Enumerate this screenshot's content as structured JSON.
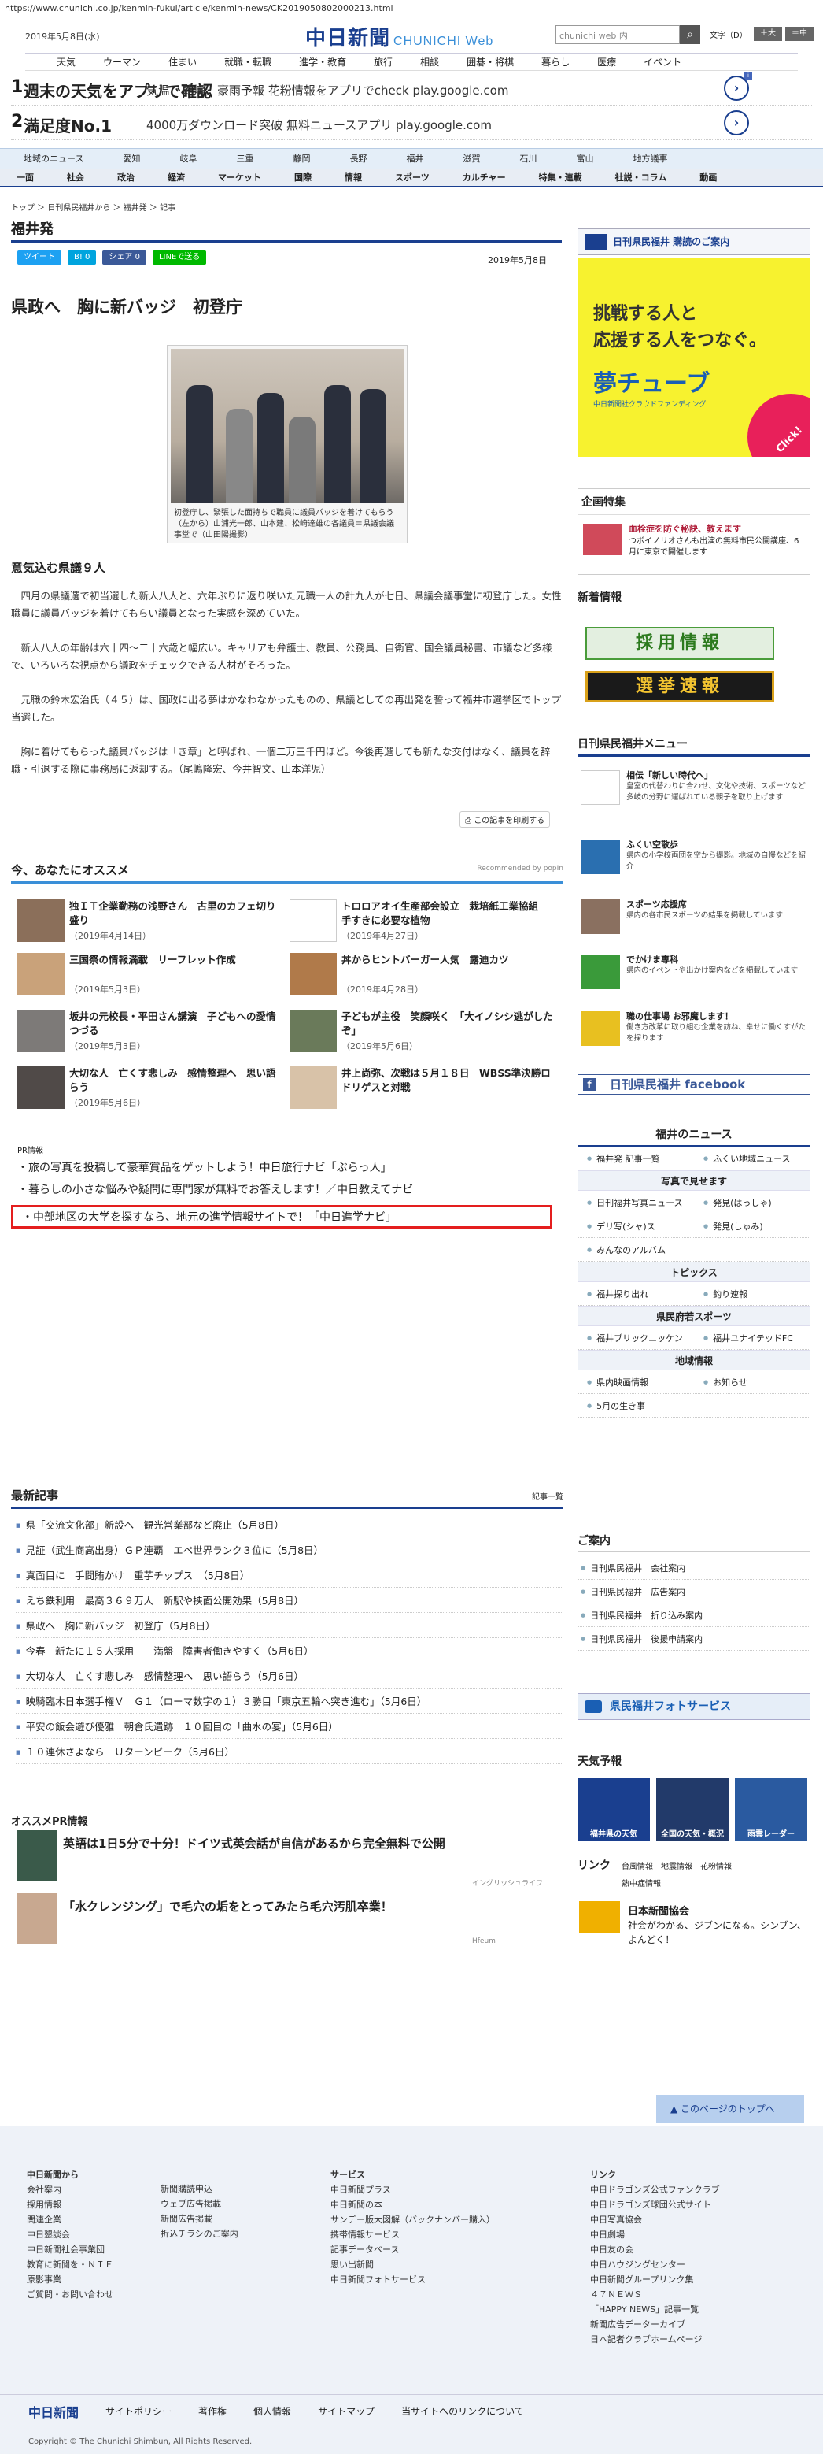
{
  "url": "https://www.chunichi.co.jp/kenmin-fukui/article/kenmin-news/CK2019050802000213.html",
  "header": {
    "date": "2019年5月8日(水)",
    "logo": "中日新聞",
    "logo_sub": "CHUNICHI Web",
    "search_placeholder": "chunichi web 内",
    "font_label": "文字（D）",
    "font_big": "＋大",
    "font_mid": "＝中"
  },
  "topnav": [
    "天気",
    "ウーマン",
    "住まい",
    "就職・転職",
    "進学・教育",
    "旅行",
    "相談",
    "囲碁・将棋",
    "暮らし",
    "医療",
    "イベント"
  ],
  "ads": [
    {
      "num": "1",
      "title": "週末の天気をアプリで確認",
      "desc": "気温、乾燥、豪雨予報 花粉情報をアプリでcheck play.google.com"
    },
    {
      "num": "2",
      "title": "満足度No.1",
      "desc": "4000万ダウンロード突破 無料ニュースアプリ play.google.com"
    }
  ],
  "regnav": [
    "地域のニュース",
    "愛知",
    "岐阜",
    "三重",
    "静岡",
    "長野",
    "福井",
    "滋賀",
    "石川",
    "富山",
    "地方議事"
  ],
  "catnav": [
    "一面",
    "社会",
    "政治",
    "経済",
    "マーケット",
    "国際",
    "情報",
    "スポーツ",
    "カルチャー",
    "特集・連載",
    "社説・コラム",
    "動画"
  ],
  "breadcrumb": "トップ ＞ 日刊県民福井から ＞ 福井発 ＞ 記事",
  "section": "福井発",
  "share": {
    "tweet": "ツイート",
    "hatena": "B! 0",
    "fb": "シェア 0",
    "line": "LINEで送る"
  },
  "article": {
    "date": "2019年5月8日",
    "title": "県政へ　胸に新バッジ　初登庁",
    "caption": "初登庁し、緊張した面持ちで職員に議員バッジを着けてもらう（左から）山浦光一郎、山本建、松崎達雄の各議員＝県議会議事堂で（山田陽撮影）",
    "subhead": "意気込む県議９人",
    "paragraphs": [
      "　四月の県議選で初当選した新人八人と、六年ぶりに返り咲いた元職一人の計九人が七日、県議会議事堂に初登庁した。女性職員に議員バッジを着けてもらい議員となった実感を深めていた。",
      "　新人八人の年齢は六十四〜二十六歳と幅広い。キャリアも弁護士、教員、公務員、自衛官、国会議員秘書、市議など多様で、いろいろな視点から議政をチェックできる人材がそろった。",
      "　元職の鈴木宏治氏（４５）は、国政に出る夢はかなわなかったものの、県議としての再出発を誓って福井市選挙区でトップ当選した。",
      "　胸に着けてもらった議員バッジは「き章」と呼ばれ、一個二万三千円ほど。今後再選しても新たな交付はなく、議員を辞職・引退する際に事務局に返却する。（尾嶋隆宏、今井智文、山本洋児）"
    ],
    "print": "この記事を印刷する"
  },
  "recommend": {
    "title": "今、あなたにオススメ",
    "powered": "Recommended by popIn",
    "items": [
      {
        "title": "独ＩＴ企業勤務の浅野さん　古里のカフェ切り盛り",
        "date": "（2019年4月14日）"
      },
      {
        "title": "トロロアオイ生産部会設立　栽培紙工業協組　手すきに必要な植物",
        "date": "（2019年4月27日）"
      },
      {
        "title": "三国祭の情報満載　リーフレット作成",
        "date": "（2019年5月3日）"
      },
      {
        "title": "丼からヒントバーガー人気　露迪カツ",
        "date": "（2019年4月28日）"
      },
      {
        "title": "坂井の元校長・平田さん講演　子どもへの愛情つづる",
        "date": "（2019年5月3日）"
      },
      {
        "title": "子どもが主役　笑顔咲く　「大イノシシ逃がしたぞ」",
        "date": "（2019年5月6日）"
      },
      {
        "title": "大切な人　亡くす悲しみ　感情整理へ　思い語らう",
        "date": "（2019年5月6日）"
      },
      {
        "title": "井上尚弥、次戦は５月１８日　WBSS準決勝ロドリゲスと対戦",
        "date": ""
      }
    ]
  },
  "pr": {
    "label": "PR情報",
    "items": [
      "旅の写真を投稿して豪華賞品をゲットしよう！中日旅行ナビ「ぶらっ人」",
      "暮らしの小さな悩みや疑問に専門家が無料でお答えします！／中日教えてナビ",
      "中部地区の大学を探すなら、地元の進学情報サイトで！「中日進学ナビ」"
    ]
  },
  "latest": {
    "title": "最新記事",
    "more": "記事一覧",
    "items": [
      "県「交流文化部」新設へ　観光営業部など廃止（5月8日）",
      "見証（武生商高出身）ＧＰ連覇　エペ世界ランク３位に（5月8日）",
      "真面目に　手間賄かけ　重芋チップス　（5月8日）",
      "えち鉄利用　最高３６９万人　新駅や挟面公開効果（5月8日）",
      "県政へ　胸に新バッジ　初登庁（5月8日）",
      "今春　新たに１５人採用　　満盤　障害者働きやすく（5月6日）",
      "大切な人　亡くす悲しみ　感情整理へ　思い語らう（5月6日）",
      "映騎臨木日本選手権Ｖ　Ｇ１（ローマ数字の１）３勝目「東京五輪へ突き進む」（5月6日）",
      "平安の飯会遊び優雅　朝倉氏遺跡　１０回目の「曲水の宴」（5月6日）",
      "１０連休さよなら　Ｕターンピーク（5月6日）"
    ]
  },
  "ospr": {
    "title": "オススメPR情報",
    "items": [
      {
        "title": "英語は1日5分で十分！ドイツ式英会話が自信があるから完全無料で公開",
        "src": "イングリッシュライフ"
      },
      {
        "title": "「水クレンジング」で毛穴の垢をとってみたら毛穴汚肌卒業！",
        "src": "Hfeum"
      }
    ]
  },
  "side": {
    "banner_top": "日刊県民福井 購読のご案内",
    "dream": {
      "line1": "挑戦する人と",
      "line2": "応援する人をつなぐ。",
      "brand": "夢チューブ",
      "sub": "中日新聞社クラウドファンディング",
      "click": "Click!"
    },
    "kikaku": {
      "title": "企画特集",
      "head": "血栓症を防ぐ秘訣、教えます",
      "text": "つボイノリオさんも出演の無料市民公開講座、6月に東京で開催します"
    },
    "info": {
      "title": "新着情報",
      "b1": "採用情報",
      "b2": "選挙速報"
    },
    "menu": {
      "title": "日刊県民福井メニュー",
      "items": [
        {
          "h": "相伝「新しい時代へ」",
          "x": "皇室の代替わりに合わせ、文化や技術、スポーツなど多岐の分野に運ばれている親子を取り上げます"
        },
        {
          "h": "ふくい空散歩",
          "x": "県内の小学校両団を空から撮影。地域の自慢などを紹介"
        },
        {
          "h": "スポーツ応援席",
          "x": "県内の各市民スポーツの結果を掲載しています"
        },
        {
          "h": "でかけま専科",
          "x": "県内のイベントや出かけ案内などを掲載しています"
        },
        {
          "h": "職の仕事場 お邪魔します！",
          "x": "働き方改革に取り組む企業を訪ね、幸せに働くすがたを探ります"
        }
      ]
    },
    "facebook": "日刊県民福井 facebook",
    "fnews": {
      "title": "福井のニュース",
      "r1": [
        "福井発 記事一覧",
        "ふくい地域ニュース"
      ],
      "photo": "写真で見せます",
      "r2": [
        "日刊福井写真ニュース",
        "発見(はっしゃ)"
      ],
      "r3": [
        "デリ写(シャ)ス",
        "発見(しゅみ)"
      ],
      "r4": [
        "みんなのアルバム"
      ],
      "topics": "トピックス",
      "r5": [
        "福井探り出れ",
        "釣り速報"
      ],
      "sports": "県民府若スポーツ",
      "r6": [
        "福井ブリックニッケン",
        "福井ユナイテッドFC"
      ],
      "chiiki": "地域情報",
      "r7": [
        "県内映画情報",
        "お知らせ"
      ],
      "r8": [
        "5月の生き事"
      ]
    },
    "annai": {
      "title": "ご案内",
      "items": [
        "日刊県民福井　会社案内",
        "日刊県民福井　広告案内",
        "日刊県民福井　折り込み案内",
        "日刊県民福井　後援申請案内"
      ]
    },
    "photoservice": "県民福井フォトサービス",
    "weather": {
      "title": "天気予報",
      "w1": "福井県の天気",
      "w2": "全国の天気・概況",
      "w3": "雨雲レーダー"
    },
    "link": {
      "title": "リンク",
      "items": [
        "台風情報",
        "地震情報",
        "花粉情報",
        "熱中症情報"
      ]
    },
    "nihon": {
      "title": "日本新聞協会",
      "text": "社会がわかる、ジブンになる。シンブン、よんどく！"
    }
  },
  "footer": {
    "totop": "このページのトップへ",
    "c1": {
      "h": "中日新聞から",
      "items": [
        "会社案内",
        "採用情報",
        "関連企業",
        "中日懇談会",
        "中日新聞社会事業団",
        "教育に新聞を・ＮＩＥ",
        "原影事業",
        "ご質問・お問い合わせ"
      ]
    },
    "c2": [
      "新聞購読申込",
      "ウェブ広告掲載",
      "新聞広告掲載",
      "折込チラシのご案内"
    ],
    "c3": {
      "h": "サービス",
      "items": [
        "中日新聞プラス",
        "中日新聞の本",
        "サンデー版大図解（バックナンバー購入）",
        "携帯情報サービス",
        "記事データベース",
        "思い出新聞",
        "中日新聞フォトサービス"
      ]
    },
    "c4": {
      "h": "リンク",
      "items": [
        "中日ドラゴンズ公式ファンクラブ",
        "中日ドラゴンズ球団公式サイト",
        "中日写真協会",
        "中日劇場",
        "中日友の会",
        "中日ハウジングセンター",
        "中日新聞グループリンク集",
        "４７ＮＥＷＳ",
        "「HAPPY NEWS」記事一覧",
        "新聞広告データーカイブ",
        "日本記者クラブホームページ"
      ]
    },
    "bar": [
      "中日新聞",
      "サイトポリシー",
      "著作権",
      "個人情報",
      "サイトマップ",
      "当サイトへのリンクについて"
    ],
    "copy": "Copyright © The Chunichi Shimbun, All Rights Reserved."
  },
  "colors": {
    "brand": "#1a3f8f",
    "accent": "#3a8fd8",
    "red": "#e41e1e",
    "yellow": "#f7f22f"
  }
}
